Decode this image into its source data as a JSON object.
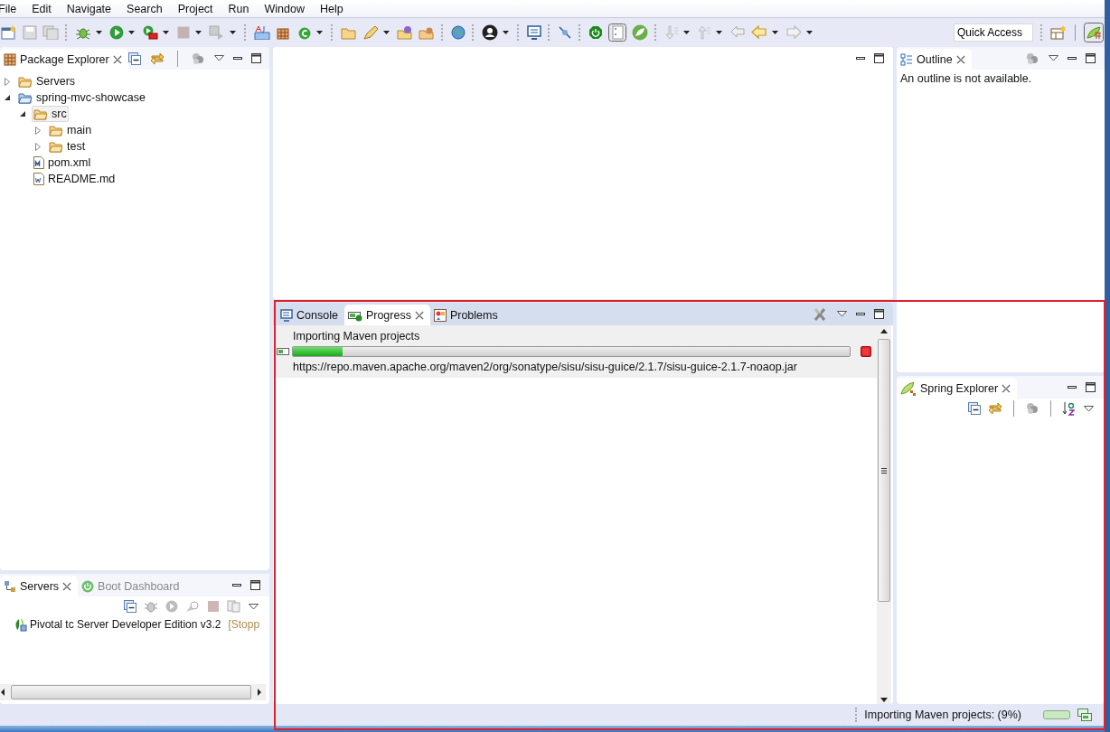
{
  "menu": [
    {
      "label": "File"
    },
    {
      "label": "Edit"
    },
    {
      "label": "Navigate"
    },
    {
      "label": "Search"
    },
    {
      "label": "Project"
    },
    {
      "label": "Run"
    },
    {
      "label": "Window"
    },
    {
      "label": "Help"
    }
  ],
  "toolbar": {
    "quick_access": "Quick Access"
  },
  "package_explorer": {
    "title": "Package Explorer",
    "tree": [
      {
        "label": "Servers",
        "kind": "folder",
        "expanded": false,
        "selected": false
      },
      {
        "label": "spring-mvc-showcase",
        "kind": "project",
        "expanded": true,
        "selected": false,
        "children": [
          {
            "label": "src",
            "kind": "folder",
            "expanded": true,
            "selected": true,
            "children": [
              {
                "label": "main",
                "kind": "folder",
                "expanded": false,
                "selected": false
              },
              {
                "label": "test",
                "kind": "folder",
                "expanded": false,
                "selected": false
              }
            ]
          },
          {
            "label": "pom.xml",
            "kind": "maven-file",
            "selected": false
          },
          {
            "label": "README.md",
            "kind": "text-file",
            "selected": false
          }
        ]
      }
    ]
  },
  "servers_panel": {
    "tabs": [
      {
        "label": "Servers",
        "selected": true
      },
      {
        "label": "Boot Dashboard",
        "selected": false
      }
    ],
    "servers": [
      {
        "name": "Pivotal tc Server Developer Edition v3.2",
        "state": "[Stopp"
      }
    ]
  },
  "bottom_panel": {
    "tabs": [
      {
        "label": "Console",
        "kind": "console",
        "selected": false
      },
      {
        "label": "Progress",
        "kind": "progress",
        "selected": true
      },
      {
        "label": "Problems",
        "kind": "problems",
        "selected": false
      }
    ],
    "jobs": [
      {
        "title": "Importing Maven projects",
        "level": 0.09,
        "detail": "https://repo.maven.apache.org/maven2/org/sonatype/sisu/sisu-guice/2.1.7/sisu-guice-2.1.7-noaop.jar"
      }
    ]
  },
  "outline": {
    "title": "Outline",
    "message": "An outline is not available."
  },
  "spring_explorer": {
    "title": "Spring Explorer"
  },
  "status_bar": {
    "message": "Importing Maven projects: (9%)"
  }
}
